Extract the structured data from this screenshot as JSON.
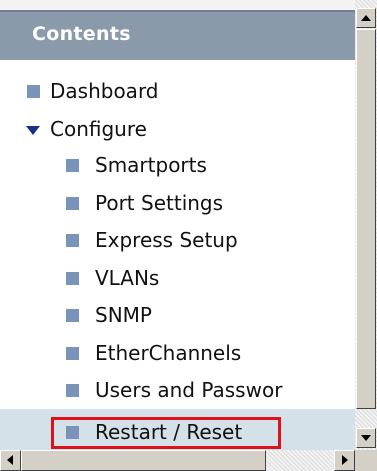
{
  "header": {
    "title": "Contents"
  },
  "nav": {
    "dashboard": "Dashboard",
    "configure": "Configure",
    "children": [
      "Smartports",
      "Port Settings",
      "Express Setup",
      "VLANs",
      "SNMP",
      "EtherChannels",
      "Users and Passwor",
      "Restart / Reset"
    ]
  },
  "colors": {
    "header_bg": "#8a9aab",
    "bullet": "#7a93b8",
    "expand_arrow": "#1b2f8a",
    "selected_bg": "#d5e1e9",
    "highlight_border": "#e0101a"
  },
  "icons": {
    "bullet": "square-bullet-icon",
    "expanded": "triangle-down-icon"
  }
}
